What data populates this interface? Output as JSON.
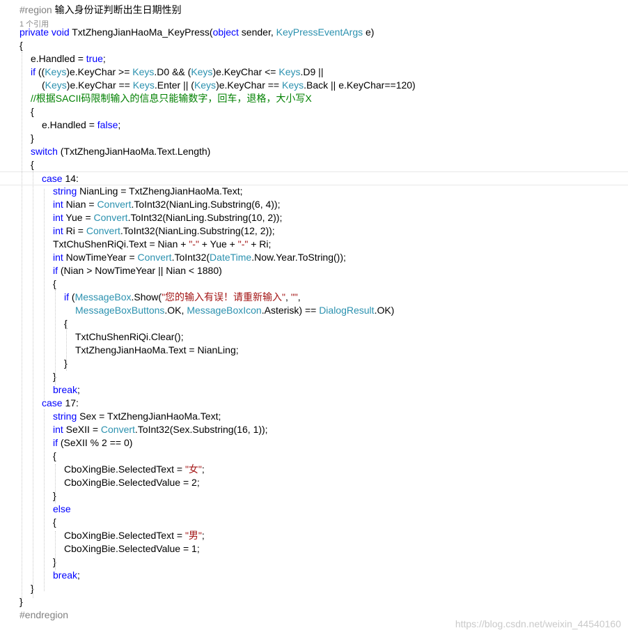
{
  "editor": {
    "lines": [
      [
        {
          "c": "pp",
          "t": "#region "
        },
        {
          "c": "plain",
          "t": "输入身份证判断出生日期性别"
        }
      ],
      [
        {
          "c": "codelens",
          "t": "1 个引用"
        }
      ],
      [
        {
          "c": "kw",
          "t": "private"
        },
        {
          "c": "plain",
          "t": " "
        },
        {
          "c": "kw",
          "t": "void"
        },
        {
          "c": "plain",
          "t": " TxtZhengJianHaoMa_KeyPress("
        },
        {
          "c": "kw",
          "t": "object"
        },
        {
          "c": "plain",
          "t": " sender, "
        },
        {
          "c": "ty",
          "t": "KeyPressEventArgs"
        },
        {
          "c": "plain",
          "t": " e)"
        }
      ],
      [
        {
          "c": "plain",
          "t": "{"
        }
      ],
      [
        {
          "c": "plain",
          "t": "e.Handled = "
        },
        {
          "c": "kw",
          "t": "true"
        },
        {
          "c": "plain",
          "t": ";"
        }
      ],
      [
        {
          "c": "kw",
          "t": "if"
        },
        {
          "c": "plain",
          "t": " (("
        },
        {
          "c": "ty",
          "t": "Keys"
        },
        {
          "c": "plain",
          "t": ")e.KeyChar >= "
        },
        {
          "c": "ty",
          "t": "Keys"
        },
        {
          "c": "plain",
          "t": ".D0 && ("
        },
        {
          "c": "ty",
          "t": "Keys"
        },
        {
          "c": "plain",
          "t": ")e.KeyChar <= "
        },
        {
          "c": "ty",
          "t": "Keys"
        },
        {
          "c": "plain",
          "t": ".D9 ||"
        }
      ],
      [
        {
          "c": "plain",
          "t": "("
        },
        {
          "c": "ty",
          "t": "Keys"
        },
        {
          "c": "plain",
          "t": ")e.KeyChar == "
        },
        {
          "c": "ty",
          "t": "Keys"
        },
        {
          "c": "plain",
          "t": ".Enter || ("
        },
        {
          "c": "ty",
          "t": "Keys"
        },
        {
          "c": "plain",
          "t": ")e.KeyChar == "
        },
        {
          "c": "ty",
          "t": "Keys"
        },
        {
          "c": "plain",
          "t": ".Back || e.KeyChar==120)"
        }
      ],
      [
        {
          "c": "cm",
          "t": "//根据SACII码限制输入的信息只能输数字，回车，退格，大小写X"
        }
      ],
      [
        {
          "c": "plain",
          "t": "{"
        }
      ],
      [
        {
          "c": "plain",
          "t": "e.Handled = "
        },
        {
          "c": "kw",
          "t": "false"
        },
        {
          "c": "plain",
          "t": ";"
        }
      ],
      [
        {
          "c": "plain",
          "t": "}"
        }
      ],
      [
        {
          "c": "kw",
          "t": "switch"
        },
        {
          "c": "plain",
          "t": " (TxtZhengJianHaoMa.Text.Length)"
        }
      ],
      [
        {
          "c": "plain",
          "t": "{"
        }
      ],
      [
        {
          "c": "kw",
          "t": "case"
        },
        {
          "c": "plain",
          "t": " 14:"
        }
      ],
      [
        {
          "c": "kw",
          "t": "string"
        },
        {
          "c": "plain",
          "t": " NianLing = TxtZhengJianHaoMa.Text;"
        }
      ],
      [
        {
          "c": "kw",
          "t": "int"
        },
        {
          "c": "plain",
          "t": " Nian = "
        },
        {
          "c": "ty",
          "t": "Convert"
        },
        {
          "c": "plain",
          "t": ".ToInt32(NianLing.Substring(6, 4));"
        }
      ],
      [
        {
          "c": "kw",
          "t": "int"
        },
        {
          "c": "plain",
          "t": " Yue = "
        },
        {
          "c": "ty",
          "t": "Convert"
        },
        {
          "c": "plain",
          "t": ".ToInt32(NianLing.Substring(10, 2));"
        }
      ],
      [
        {
          "c": "kw",
          "t": "int"
        },
        {
          "c": "plain",
          "t": " Ri = "
        },
        {
          "c": "ty",
          "t": "Convert"
        },
        {
          "c": "plain",
          "t": ".ToInt32(NianLing.Substring(12, 2));"
        }
      ],
      [
        {
          "c": "plain",
          "t": "TxtChuShenRiQi.Text = Nian + "
        },
        {
          "c": "st",
          "t": "\"-\""
        },
        {
          "c": "plain",
          "t": " + Yue + "
        },
        {
          "c": "st",
          "t": "\"-\""
        },
        {
          "c": "plain",
          "t": " + Ri;"
        }
      ],
      [
        {
          "c": "kw",
          "t": "int"
        },
        {
          "c": "plain",
          "t": " NowTimeYear = "
        },
        {
          "c": "ty",
          "t": "Convert"
        },
        {
          "c": "plain",
          "t": ".ToInt32("
        },
        {
          "c": "ty",
          "t": "DateTime"
        },
        {
          "c": "plain",
          "t": ".Now.Year.ToString());"
        }
      ],
      [
        {
          "c": "kw",
          "t": "if"
        },
        {
          "c": "plain",
          "t": " (Nian > NowTimeYear || Nian < 1880)"
        }
      ],
      [
        {
          "c": "plain",
          "t": "{"
        }
      ],
      [
        {
          "c": "kw",
          "t": "if"
        },
        {
          "c": "plain",
          "t": " ("
        },
        {
          "c": "ty",
          "t": "MessageBox"
        },
        {
          "c": "plain",
          "t": ".Show("
        },
        {
          "c": "st",
          "t": "\"您的输入有误！请重新输入\""
        },
        {
          "c": "plain",
          "t": ", "
        },
        {
          "c": "st",
          "t": "\"\""
        },
        {
          "c": "plain",
          "t": ","
        }
      ],
      [
        {
          "c": "ty",
          "t": "MessageBoxButtons"
        },
        {
          "c": "plain",
          "t": ".OK, "
        },
        {
          "c": "ty",
          "t": "MessageBoxIcon"
        },
        {
          "c": "plain",
          "t": ".Asterisk) == "
        },
        {
          "c": "ty",
          "t": "DialogResult"
        },
        {
          "c": "plain",
          "t": ".OK)"
        }
      ],
      [
        {
          "c": "plain",
          "t": "{"
        }
      ],
      [
        {
          "c": "plain",
          "t": "TxtChuShenRiQi.Clear();"
        }
      ],
      [
        {
          "c": "plain",
          "t": "TxtZhengJianHaoMa.Text = NianLing;"
        }
      ],
      [
        {
          "c": "plain",
          "t": "}"
        }
      ],
      [
        {
          "c": "plain",
          "t": "}"
        }
      ],
      [
        {
          "c": "kw",
          "t": "break"
        },
        {
          "c": "plain",
          "t": ";"
        }
      ],
      [
        {
          "c": "kw",
          "t": "case"
        },
        {
          "c": "plain",
          "t": " 17:"
        }
      ],
      [
        {
          "c": "kw",
          "t": "string"
        },
        {
          "c": "plain",
          "t": " Sex = TxtZhengJianHaoMa.Text;"
        }
      ],
      [
        {
          "c": "kw",
          "t": "int"
        },
        {
          "c": "plain",
          "t": " SeXII = "
        },
        {
          "c": "ty",
          "t": "Convert"
        },
        {
          "c": "plain",
          "t": ".ToInt32(Sex.Substring(16, 1));"
        }
      ],
      [
        {
          "c": "kw",
          "t": "if"
        },
        {
          "c": "plain",
          "t": " (SeXII % 2 == 0)"
        }
      ],
      [
        {
          "c": "plain",
          "t": "{"
        }
      ],
      [
        {
          "c": "plain",
          "t": "CboXingBie.SelectedText = "
        },
        {
          "c": "st",
          "t": "\"女\""
        },
        {
          "c": "plain",
          "t": ";"
        }
      ],
      [
        {
          "c": "plain",
          "t": "CboXingBie.SelectedValue = 2;"
        }
      ],
      [
        {
          "c": "plain",
          "t": "}"
        }
      ],
      [
        {
          "c": "kw",
          "t": "else"
        }
      ],
      [
        {
          "c": "plain",
          "t": "{"
        }
      ],
      [
        {
          "c": "plain",
          "t": "CboXingBie.SelectedText = "
        },
        {
          "c": "st",
          "t": "\"男\""
        },
        {
          "c": "plain",
          "t": ";"
        }
      ],
      [
        {
          "c": "plain",
          "t": "CboXingBie.SelectedValue = 1;"
        }
      ],
      [
        {
          "c": "plain",
          "t": "}"
        }
      ],
      [
        {
          "c": "kw",
          "t": "break"
        },
        {
          "c": "plain",
          "t": ";"
        }
      ],
      [
        {
          "c": "plain",
          "t": "}"
        }
      ],
      [
        {
          "c": "plain",
          "t": "}"
        }
      ],
      [
        {
          "c": "pp",
          "t": "#endregion"
        }
      ]
    ]
  },
  "watermark": "https://blog.csdn.net/weixin_44540160",
  "colors": {
    "keyword": "#0000ff",
    "type": "#2b91af",
    "string": "#a31515",
    "comment": "#008000",
    "preprocessor": "#808080"
  }
}
